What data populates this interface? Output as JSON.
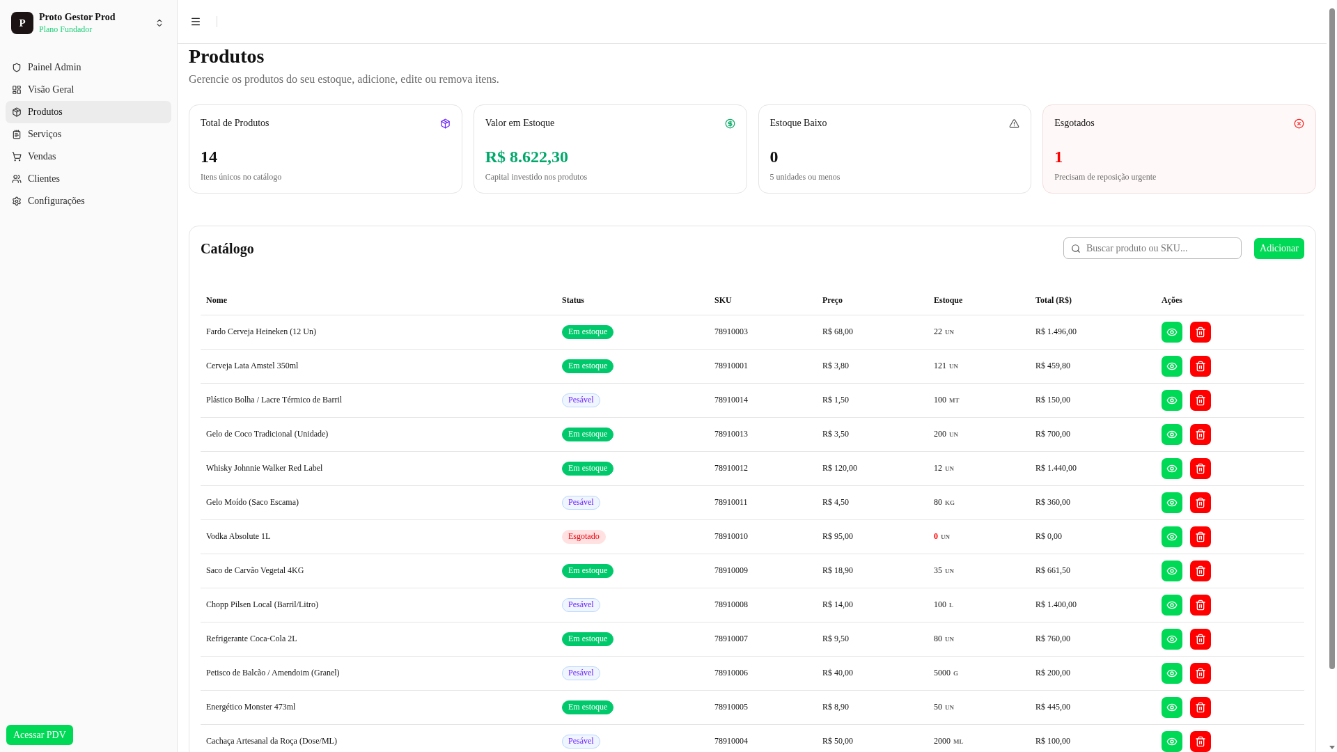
{
  "sidebar": {
    "brand": {
      "initial": "P",
      "name": "Proto Gestor Prod",
      "plan": "Plano Fundador"
    },
    "items": [
      {
        "label": "Painel Admin",
        "selected": false
      },
      {
        "label": "Visão Geral",
        "selected": false
      },
      {
        "label": "Produtos",
        "selected": true
      },
      {
        "label": "Serviços",
        "selected": false
      },
      {
        "label": "Vendas",
        "selected": false
      },
      {
        "label": "Clientes",
        "selected": false
      },
      {
        "label": "Configurações",
        "selected": false
      }
    ],
    "footer_button": "Acessar PDV"
  },
  "page": {
    "title": "Produtos",
    "subtitle": "Gerencie os produtos do seu estoque, adicione, edite ou remova itens."
  },
  "stats": [
    {
      "kind": "total",
      "title": "Total de Produtos",
      "value": "14",
      "caption": "Itens únicos no catálogo"
    },
    {
      "kind": "value",
      "title": "Valor em Estoque",
      "value": "R$ 8.622,30",
      "caption": "Capital investido nos produtos"
    },
    {
      "kind": "low",
      "title": "Estoque Baixo",
      "value": "0",
      "caption": "5 unidades ou menos"
    },
    {
      "kind": "out",
      "title": "Esgotados",
      "value": "1",
      "caption": "Precisam de reposição urgente"
    }
  ],
  "catalog": {
    "title": "Catálogo",
    "search": {
      "placeholder": "Buscar produto ou SKU..."
    },
    "add_button": "Adicionar",
    "table": {
      "columns": [
        "Nome",
        "Status",
        "SKU",
        "Preço",
        "Estoque",
        "Total (R$)",
        "Ações"
      ],
      "rows": [
        {
          "name": "Fardo Cerveja Heineken (12 Un)",
          "status": {
            "kind": "in_stock",
            "label": "Em estoque"
          },
          "sku": "78910003",
          "price": "R$ 68,00",
          "stock": {
            "quantity": "22",
            "unit": "UN"
          },
          "total": "R$ 1.496,00"
        },
        {
          "name": "Cerveja Lata Amstel 350ml",
          "status": {
            "kind": "in_stock",
            "label": "Em estoque"
          },
          "sku": "78910001",
          "price": "R$ 3,80",
          "stock": {
            "quantity": "121",
            "unit": "UN"
          },
          "total": "R$ 459,80"
        },
        {
          "name": "Plástico Bolha / Lacre Térmico de Barril",
          "status": {
            "kind": "weighable",
            "label": "Pesável"
          },
          "sku": "78910014",
          "price": "R$ 1,50",
          "stock": {
            "quantity": "100",
            "unit": "MT"
          },
          "total": "R$ 150,00"
        },
        {
          "name": "Gelo de Coco Tradicional (Unidade)",
          "status": {
            "kind": "in_stock",
            "label": "Em estoque"
          },
          "sku": "78910013",
          "price": "R$ 3,50",
          "stock": {
            "quantity": "200",
            "unit": "UN"
          },
          "total": "R$ 700,00"
        },
        {
          "name": "Whisky Johnnie Walker Red Label",
          "status": {
            "kind": "in_stock",
            "label": "Em estoque"
          },
          "sku": "78910012",
          "price": "R$ 120,00",
          "stock": {
            "quantity": "12",
            "unit": "UN"
          },
          "total": "R$ 1.440,00"
        },
        {
          "name": "Gelo Moído (Saco Escama)",
          "status": {
            "kind": "weighable",
            "label": "Pesável"
          },
          "sku": "78910011",
          "price": "R$ 4,50",
          "stock": {
            "quantity": "80",
            "unit": "KG"
          },
          "total": "R$ 360,00"
        },
        {
          "name": "Vodka Absolute 1L",
          "status": {
            "kind": "out_of_stock",
            "label": "Esgotado"
          },
          "sku": "78910010",
          "price": "R$ 95,00",
          "stock": {
            "quantity": "0",
            "unit": "UN"
          },
          "total": "R$ 0,00"
        },
        {
          "name": "Saco de Carvão Vegetal 4KG",
          "status": {
            "kind": "in_stock",
            "label": "Em estoque"
          },
          "sku": "78910009",
          "price": "R$ 18,90",
          "stock": {
            "quantity": "35",
            "unit": "UN"
          },
          "total": "R$ 661,50"
        },
        {
          "name": "Chopp Pilsen Local (Barril/Litro)",
          "status": {
            "kind": "weighable",
            "label": "Pesável"
          },
          "sku": "78910008",
          "price": "R$ 14,00",
          "stock": {
            "quantity": "100",
            "unit": "L"
          },
          "total": "R$ 1.400,00"
        },
        {
          "name": "Refrigerante Coca-Cola 2L",
          "status": {
            "kind": "in_stock",
            "label": "Em estoque"
          },
          "sku": "78910007",
          "price": "R$ 9,50",
          "stock": {
            "quantity": "80",
            "unit": "UN"
          },
          "total": "R$ 760,00"
        },
        {
          "name": "Petisco de Balcão / Amendoim (Granel)",
          "status": {
            "kind": "weighable",
            "label": "Pesável"
          },
          "sku": "78910006",
          "price": "R$ 40,00",
          "stock": {
            "quantity": "5000",
            "unit": "G"
          },
          "total": "R$ 200,00"
        },
        {
          "name": "Energético Monster 473ml",
          "status": {
            "kind": "in_stock",
            "label": "Em estoque"
          },
          "sku": "78910005",
          "price": "R$ 8,90",
          "stock": {
            "quantity": "50",
            "unit": "UN"
          },
          "total": "R$ 445,00"
        },
        {
          "name": "Cachaça Artesanal da Roça (Dose/ML)",
          "status": {
            "kind": "weighable",
            "label": "Pesável"
          },
          "sku": "78910004",
          "price": "R$ 50,00",
          "stock": {
            "quantity": "2000",
            "unit": "ML"
          },
          "total": "R$ 100,00"
        }
      ]
    }
  }
}
